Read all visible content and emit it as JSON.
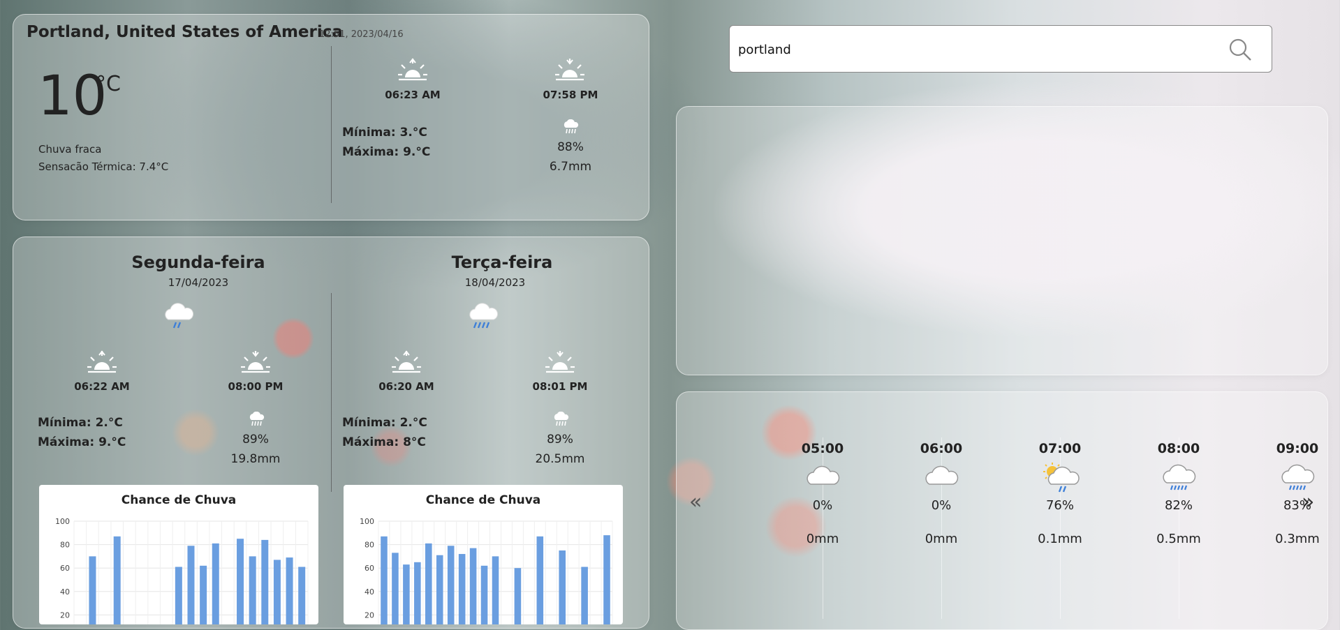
{
  "current": {
    "location": "Portland, United States of America",
    "datetime": "12:51, 2023/04/16",
    "temp": "10",
    "unit": "°C",
    "description": "Chuva fraca",
    "feels_like": "Sensacão Térmica: 7.4°C",
    "sunrise": "06:23 AM",
    "sunset": "07:58 PM",
    "min": "Mínima: 3.°C",
    "max": "Máxima: 9.°C",
    "humidity": "88%",
    "precip": "6.7mm",
    "sunrise_icon": "sunrise-icon",
    "sunset_icon": "sunset-icon",
    "rain_icon": "rain-cloud-icon"
  },
  "search": {
    "value": "portland",
    "icon": "search-icon"
  },
  "days": [
    {
      "name": "Segunda-feira",
      "date": "17/04/2023",
      "sunrise": "06:22 AM",
      "sunset": "08:00 PM",
      "min": "Mínima: 2.°C",
      "max": "Máxima: 9.°C",
      "humidity": "89%",
      "precip": "19.8mm",
      "chart_title": "Chance de Chuva"
    },
    {
      "name": "Terça-feira",
      "date": "18/04/2023",
      "sunrise": "06:20 AM",
      "sunset": "08:01 PM",
      "min": "Mínima: 2.°C",
      "max": "Máxima: 8°C",
      "humidity": "89%",
      "precip": "20.5mm",
      "chart_title": "Chance de Chuva"
    }
  ],
  "hourly": {
    "prev": "«",
    "next": "»",
    "items": [
      {
        "time": "05:00",
        "icon": "cloud-icon",
        "chance": "0%",
        "precip": "0mm"
      },
      {
        "time": "06:00",
        "icon": "cloud-icon",
        "chance": "0%",
        "precip": "0mm"
      },
      {
        "time": "07:00",
        "icon": "sun-cloud-rain-icon",
        "chance": "76%",
        "precip": "0.1mm"
      },
      {
        "time": "08:00",
        "icon": "cloud-rain-icon",
        "chance": "82%",
        "precip": "0.5mm"
      },
      {
        "time": "09:00",
        "icon": "cloud-rain-icon",
        "chance": "83%",
        "precip": "0.3mm"
      }
    ]
  },
  "colors": {
    "bar": "#6a9ee0",
    "rain": "#3d7fd8"
  },
  "chart_data": [
    {
      "type": "bar",
      "title": "Chance de Chuva",
      "ylim": [
        0,
        100
      ],
      "yticks": [
        "100",
        "80",
        "60",
        "40",
        "20"
      ],
      "grid": true,
      "values": [
        0,
        70,
        0,
        87,
        0,
        0,
        0,
        0,
        61,
        79,
        62,
        81,
        0,
        85,
        70,
        84,
        67,
        69,
        61
      ]
    },
    {
      "type": "bar",
      "title": "Chance de Chuva",
      "ylim": [
        0,
        100
      ],
      "yticks": [
        "100",
        "80",
        "60",
        "40",
        "20"
      ],
      "grid": true,
      "values": [
        87,
        73,
        63,
        65,
        81,
        71,
        79,
        72,
        77,
        62,
        70,
        0,
        60,
        0,
        87,
        0,
        75,
        0,
        61,
        0,
        88
      ]
    }
  ]
}
